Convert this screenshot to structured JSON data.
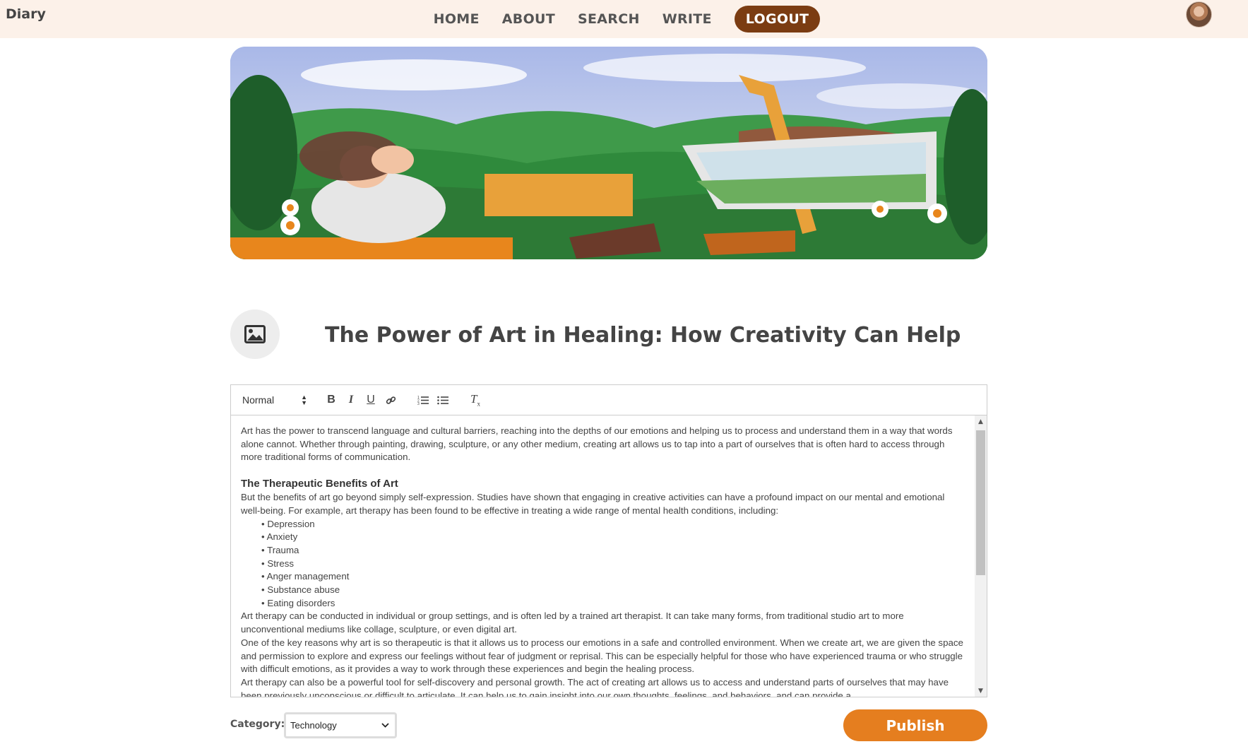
{
  "brand": "Diary",
  "nav": {
    "items": [
      "HOME",
      "ABOUT",
      "SEARCH",
      "WRITE"
    ],
    "logout": "LOGOUT"
  },
  "post": {
    "title": "The Power of Art in Healing: How Creativity Can Help Us Proc",
    "toolbar": {
      "format": "Normal"
    },
    "body": {
      "intro": "Art has the power to transcend language and cultural barriers, reaching into the depths of our emotions and helping us to process and understand them in a way that words alone cannot. Whether through painting, drawing, sculpture, or any other medium, creating art allows us to tap into a part of ourselves that is often hard to access through more traditional forms of communication.",
      "heading": "The Therapeutic Benefits of Art",
      "p1": "But the benefits of art go beyond simply self-expression. Studies have shown that engaging in creative activities can have a profound impact on our mental and emotional well-being. For example, art therapy has been found to be effective in treating a wide range of mental health conditions, including:",
      "list": [
        "Depression",
        "Anxiety",
        "Trauma",
        "Stress",
        "Anger management",
        "Substance abuse",
        "Eating disorders"
      ],
      "p2": "Art therapy can be conducted in individual or group settings, and is often led by a trained art therapist. It can take many forms, from traditional studio art to more unconventional mediums like collage, sculpture, or even digital art.",
      "p3": "One of the key reasons why art is so therapeutic is that it allows us to process our emotions in a safe and controlled environment. When we create art, we are given the space and permission to explore and express our feelings without fear of judgment or reprisal. This can be especially helpful for those who have experienced trauma or who struggle with difficult emotions, as it provides a way to work through these experiences and begin the healing process.",
      "p4": "Art therapy can also be a powerful tool for self-discovery and personal growth. The act of creating art allows us to access and understand parts of ourselves that may have been previously unconscious or difficult to articulate. It can help us to gain insight into our own thoughts, feelings, and behaviors, and can provide a"
    },
    "category_label": "Category:",
    "category": "Technology",
    "publish": "Publish"
  },
  "colors": {
    "topbar": "#fcf1e9",
    "logout": "#7b3c12",
    "publish": "#e57e1f"
  }
}
